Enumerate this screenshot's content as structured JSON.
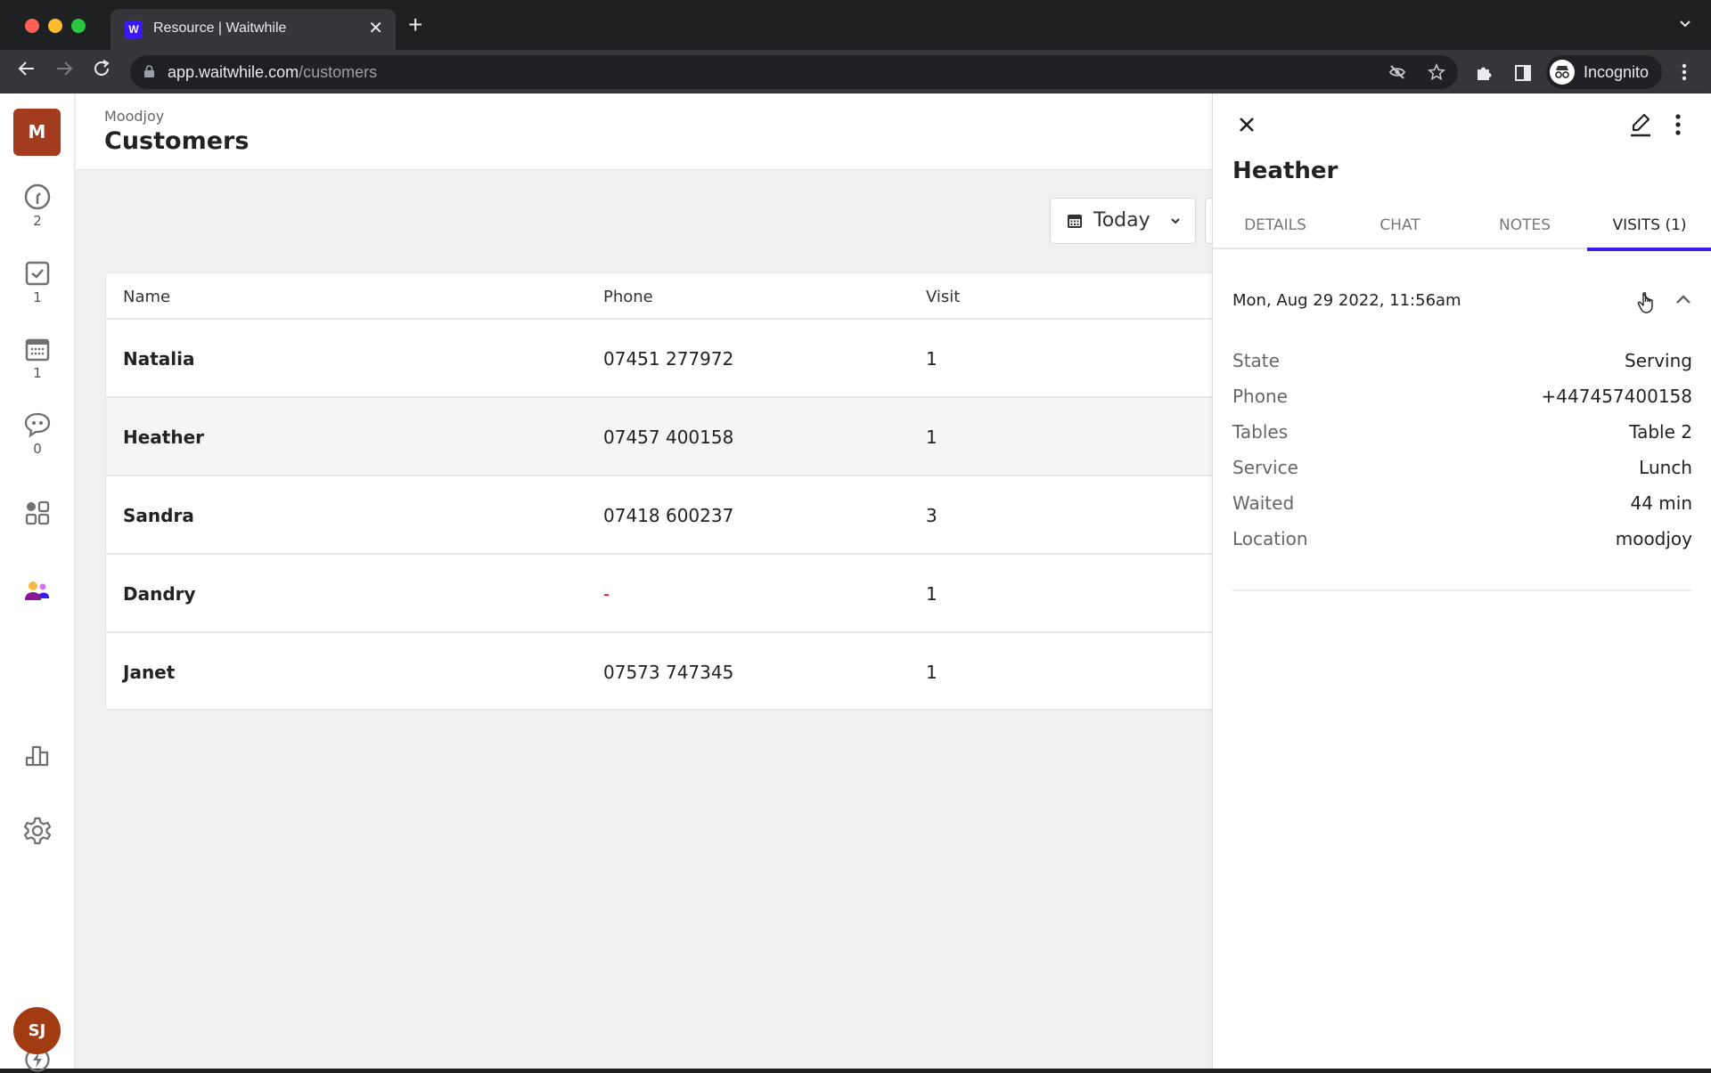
{
  "browser": {
    "tab_title": "Resource | Waitwhile",
    "favicon_label": "W",
    "url_host": "app.waitwhile.com",
    "url_path": "/customers",
    "profile_label": "Incognito",
    "icons": {
      "back": "arrow-left-icon",
      "forward": "arrow-right-icon",
      "reload": "reload-icon",
      "lock": "lock-icon",
      "tracking": "eye-off-icon",
      "bookmark": "star-icon",
      "extensions": "puzzle-icon",
      "sidepanel": "sidepanel-icon",
      "menu": "kebab-icon"
    }
  },
  "sidebar": {
    "org_initial": "M",
    "items": [
      {
        "name": "waitlist",
        "icon": "clock-icon",
        "count": "2"
      },
      {
        "name": "tasks",
        "icon": "checkbox-icon",
        "count": "1"
      },
      {
        "name": "bookings",
        "icon": "calendar-icon",
        "count": "1"
      },
      {
        "name": "messages",
        "icon": "chat-icon",
        "count": "0"
      },
      {
        "name": "apps",
        "icon": "grid-icon",
        "count": null
      },
      {
        "name": "customers",
        "icon": "users-icon",
        "count": null,
        "active": true
      },
      {
        "name": "analytics",
        "icon": "bar-chart-icon",
        "count": null
      },
      {
        "name": "settings",
        "icon": "gear-icon",
        "count": null
      },
      {
        "name": "whats-new",
        "icon": "bolt-icon",
        "count": null
      }
    ],
    "user_initials": "SJ"
  },
  "header": {
    "org_name": "Moodjoy",
    "title": "Customers"
  },
  "filters": {
    "date_label": "Today"
  },
  "table": {
    "columns": [
      "Name",
      "Phone",
      "Visit"
    ],
    "rows": [
      {
        "name": "Natalia",
        "phone": "07451 277972",
        "visits": "1"
      },
      {
        "name": "Heather",
        "phone": "07457 400158",
        "visits": "1",
        "selected": true
      },
      {
        "name": "Sandra",
        "phone": "07418 600237",
        "visits": "3"
      },
      {
        "name": "Dandry",
        "phone": "-",
        "visits": "1"
      },
      {
        "name": "Janet",
        "phone": "07573 747345",
        "visits": "1"
      }
    ]
  },
  "panel": {
    "customer_name": "Heather",
    "tabs": [
      {
        "label": "DETAILS"
      },
      {
        "label": "CHAT"
      },
      {
        "label": "NOTES"
      },
      {
        "label": "VISITS (1)",
        "active": true
      }
    ],
    "visit": {
      "datetime": "Mon, Aug 29 2022, 11:56am",
      "fields": [
        {
          "label": "State",
          "value": "Serving"
        },
        {
          "label": "Phone",
          "value": "+447457400158"
        },
        {
          "label": "Tables",
          "value": "Table 2"
        },
        {
          "label": "Service",
          "value": "Lunch"
        },
        {
          "label": "Waited",
          "value": "44 min"
        },
        {
          "label": "Location",
          "value": "moodjoy"
        }
      ]
    }
  },
  "colors": {
    "accent": "#3a1cf0",
    "org_avatar": "#a33c1f",
    "user_avatar": "#a23a12",
    "missing_value": "#d0103a"
  }
}
